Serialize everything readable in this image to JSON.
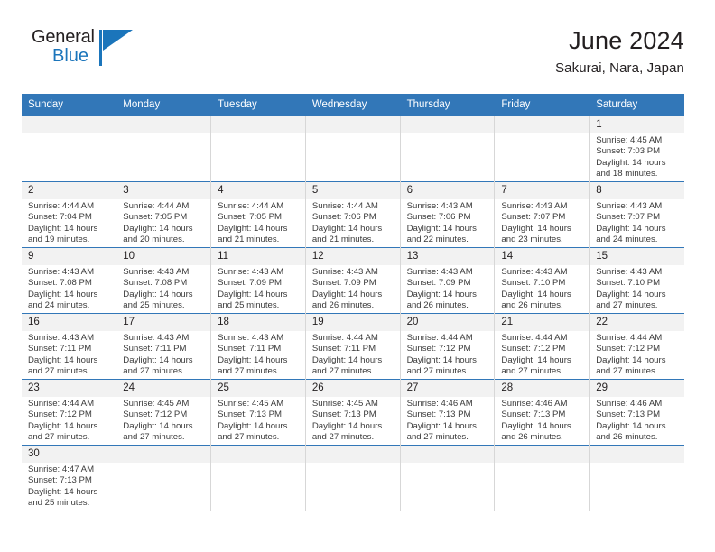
{
  "brand": {
    "name_part1": "General",
    "name_part2": "Blue",
    "accent_color": "#1b75bb"
  },
  "header": {
    "title": "June 2024",
    "location": "Sakurai, Nara, Japan"
  },
  "calendar": {
    "header_color": "#3277b8",
    "weekday_headers": [
      "Sunday",
      "Monday",
      "Tuesday",
      "Wednesday",
      "Thursday",
      "Friday",
      "Saturday"
    ],
    "weeks": [
      [
        {
          "day": "",
          "empty": true
        },
        {
          "day": "",
          "empty": true
        },
        {
          "day": "",
          "empty": true
        },
        {
          "day": "",
          "empty": true
        },
        {
          "day": "",
          "empty": true
        },
        {
          "day": "",
          "empty": true
        },
        {
          "day": "1",
          "sunrise": "Sunrise: 4:45 AM",
          "sunset": "Sunset: 7:03 PM",
          "daylight": "Daylight: 14 hours and 18 minutes."
        }
      ],
      [
        {
          "day": "2",
          "sunrise": "Sunrise: 4:44 AM",
          "sunset": "Sunset: 7:04 PM",
          "daylight": "Daylight: 14 hours and 19 minutes."
        },
        {
          "day": "3",
          "sunrise": "Sunrise: 4:44 AM",
          "sunset": "Sunset: 7:05 PM",
          "daylight": "Daylight: 14 hours and 20 minutes."
        },
        {
          "day": "4",
          "sunrise": "Sunrise: 4:44 AM",
          "sunset": "Sunset: 7:05 PM",
          "daylight": "Daylight: 14 hours and 21 minutes."
        },
        {
          "day": "5",
          "sunrise": "Sunrise: 4:44 AM",
          "sunset": "Sunset: 7:06 PM",
          "daylight": "Daylight: 14 hours and 21 minutes."
        },
        {
          "day": "6",
          "sunrise": "Sunrise: 4:43 AM",
          "sunset": "Sunset: 7:06 PM",
          "daylight": "Daylight: 14 hours and 22 minutes."
        },
        {
          "day": "7",
          "sunrise": "Sunrise: 4:43 AM",
          "sunset": "Sunset: 7:07 PM",
          "daylight": "Daylight: 14 hours and 23 minutes."
        },
        {
          "day": "8",
          "sunrise": "Sunrise: 4:43 AM",
          "sunset": "Sunset: 7:07 PM",
          "daylight": "Daylight: 14 hours and 24 minutes."
        }
      ],
      [
        {
          "day": "9",
          "sunrise": "Sunrise: 4:43 AM",
          "sunset": "Sunset: 7:08 PM",
          "daylight": "Daylight: 14 hours and 24 minutes."
        },
        {
          "day": "10",
          "sunrise": "Sunrise: 4:43 AM",
          "sunset": "Sunset: 7:08 PM",
          "daylight": "Daylight: 14 hours and 25 minutes."
        },
        {
          "day": "11",
          "sunrise": "Sunrise: 4:43 AM",
          "sunset": "Sunset: 7:09 PM",
          "daylight": "Daylight: 14 hours and 25 minutes."
        },
        {
          "day": "12",
          "sunrise": "Sunrise: 4:43 AM",
          "sunset": "Sunset: 7:09 PM",
          "daylight": "Daylight: 14 hours and 26 minutes."
        },
        {
          "day": "13",
          "sunrise": "Sunrise: 4:43 AM",
          "sunset": "Sunset: 7:09 PM",
          "daylight": "Daylight: 14 hours and 26 minutes."
        },
        {
          "day": "14",
          "sunrise": "Sunrise: 4:43 AM",
          "sunset": "Sunset: 7:10 PM",
          "daylight": "Daylight: 14 hours and 26 minutes."
        },
        {
          "day": "15",
          "sunrise": "Sunrise: 4:43 AM",
          "sunset": "Sunset: 7:10 PM",
          "daylight": "Daylight: 14 hours and 27 minutes."
        }
      ],
      [
        {
          "day": "16",
          "sunrise": "Sunrise: 4:43 AM",
          "sunset": "Sunset: 7:11 PM",
          "daylight": "Daylight: 14 hours and 27 minutes."
        },
        {
          "day": "17",
          "sunrise": "Sunrise: 4:43 AM",
          "sunset": "Sunset: 7:11 PM",
          "daylight": "Daylight: 14 hours and 27 minutes."
        },
        {
          "day": "18",
          "sunrise": "Sunrise: 4:43 AM",
          "sunset": "Sunset: 7:11 PM",
          "daylight": "Daylight: 14 hours and 27 minutes."
        },
        {
          "day": "19",
          "sunrise": "Sunrise: 4:44 AM",
          "sunset": "Sunset: 7:11 PM",
          "daylight": "Daylight: 14 hours and 27 minutes."
        },
        {
          "day": "20",
          "sunrise": "Sunrise: 4:44 AM",
          "sunset": "Sunset: 7:12 PM",
          "daylight": "Daylight: 14 hours and 27 minutes."
        },
        {
          "day": "21",
          "sunrise": "Sunrise: 4:44 AM",
          "sunset": "Sunset: 7:12 PM",
          "daylight": "Daylight: 14 hours and 27 minutes."
        },
        {
          "day": "22",
          "sunrise": "Sunrise: 4:44 AM",
          "sunset": "Sunset: 7:12 PM",
          "daylight": "Daylight: 14 hours and 27 minutes."
        }
      ],
      [
        {
          "day": "23",
          "sunrise": "Sunrise: 4:44 AM",
          "sunset": "Sunset: 7:12 PM",
          "daylight": "Daylight: 14 hours and 27 minutes."
        },
        {
          "day": "24",
          "sunrise": "Sunrise: 4:45 AM",
          "sunset": "Sunset: 7:12 PM",
          "daylight": "Daylight: 14 hours and 27 minutes."
        },
        {
          "day": "25",
          "sunrise": "Sunrise: 4:45 AM",
          "sunset": "Sunset: 7:13 PM",
          "daylight": "Daylight: 14 hours and 27 minutes."
        },
        {
          "day": "26",
          "sunrise": "Sunrise: 4:45 AM",
          "sunset": "Sunset: 7:13 PM",
          "daylight": "Daylight: 14 hours and 27 minutes."
        },
        {
          "day": "27",
          "sunrise": "Sunrise: 4:46 AM",
          "sunset": "Sunset: 7:13 PM",
          "daylight": "Daylight: 14 hours and 27 minutes."
        },
        {
          "day": "28",
          "sunrise": "Sunrise: 4:46 AM",
          "sunset": "Sunset: 7:13 PM",
          "daylight": "Daylight: 14 hours and 26 minutes."
        },
        {
          "day": "29",
          "sunrise": "Sunrise: 4:46 AM",
          "sunset": "Sunset: 7:13 PM",
          "daylight": "Daylight: 14 hours and 26 minutes."
        }
      ],
      [
        {
          "day": "30",
          "sunrise": "Sunrise: 4:47 AM",
          "sunset": "Sunset: 7:13 PM",
          "daylight": "Daylight: 14 hours and 25 minutes."
        },
        {
          "day": "",
          "empty": true
        },
        {
          "day": "",
          "empty": true
        },
        {
          "day": "",
          "empty": true
        },
        {
          "day": "",
          "empty": true
        },
        {
          "day": "",
          "empty": true
        },
        {
          "day": "",
          "empty": true
        }
      ]
    ]
  }
}
